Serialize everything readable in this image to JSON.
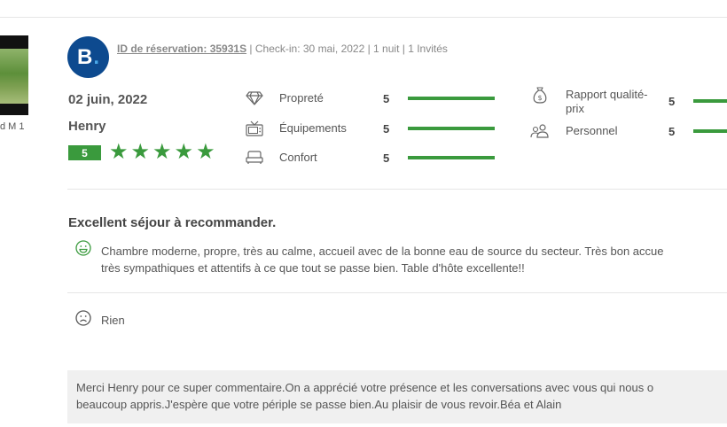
{
  "thumbnail": {
    "caption": "d M 1"
  },
  "review": {
    "logo_letter": "B",
    "logo_dot": ".",
    "reservation_link": "ID de réservation: 35931S",
    "meta": " | Check-in: 30 mai, 2022 | 1 nuit | 1 Invités",
    "date": "02 juin, 2022",
    "reviewer": "Henry",
    "overall_score": "5",
    "star_count": 5,
    "ratings": [
      {
        "label": "Propreté",
        "value": "5",
        "icon": "diamond-icon"
      },
      {
        "label": "Équipements",
        "value": "5",
        "icon": "tv-icon"
      },
      {
        "label": "Confort",
        "value": "5",
        "icon": "bed-icon"
      },
      {
        "label": "Rapport qualité-",
        "label2": "prix",
        "value": "5",
        "icon": "money-bag-icon"
      },
      {
        "label": "Personnel",
        "value": "5",
        "icon": "people-icon"
      }
    ],
    "headline": "Excellent séjour à recommander.",
    "positive_line1": "Chambre moderne, propre, très au calme, accueil avec de la bonne eau de source du secteur. Très bon accue",
    "positive_line2": "très sympathiques et attentifs à ce que tout se passe bien. Table d'hôte excellente!!",
    "negative": "Rien",
    "reply_line1": "Merci Henry pour ce super commentaire.On a apprécié votre présence et les conversations avec vous qui nous o",
    "reply_line2": "beaucoup appris.J'espère que votre périple se passe bien.Au plaisir de vous revoir.Béa et Alain"
  },
  "colors": {
    "accent_green": "#3a9a3d",
    "logo_blue": "#0d4a8f"
  }
}
